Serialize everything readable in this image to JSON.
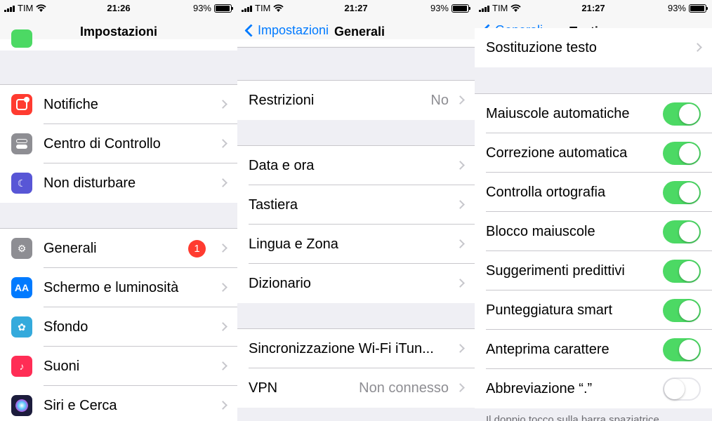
{
  "status_left": {
    "carrier": "TIM",
    "battery_text": "93%",
    "battery_level": 0.93
  },
  "panel1": {
    "time": "21:26",
    "title": "Impostazioni",
    "items": [
      {
        "label": "Notifiche",
        "icon": "notifications-icon",
        "color": "#ff3b30"
      },
      {
        "label": "Centro di Controllo",
        "icon": "control-center-icon",
        "color": "#8e8e93"
      },
      {
        "label": "Non disturbare",
        "icon": "moon-icon",
        "color": "#5856d6"
      },
      {
        "label": "Generali",
        "icon": "gear-icon",
        "color": "#8e8e93",
        "badge": "1"
      },
      {
        "label": "Schermo e luminosità",
        "icon": "display-brightness-icon",
        "color": "#007aff",
        "icon_text": "AA"
      },
      {
        "label": "Sfondo",
        "icon": "wallpaper-flower-icon",
        "color": "#34aadc"
      },
      {
        "label": "Suoni",
        "icon": "speaker-icon",
        "color": "#ff2d55"
      },
      {
        "label": "Siri e Cerca",
        "icon": "siri-icon",
        "color": "#1c1c3c"
      }
    ]
  },
  "panel2": {
    "time": "21:27",
    "back": "Impostazioni",
    "title": "Generali",
    "items": [
      {
        "label": "Restrizioni",
        "detail": "No"
      },
      {
        "label": "Data e ora"
      },
      {
        "label": "Tastiera"
      },
      {
        "label": "Lingua e Zona"
      },
      {
        "label": "Dizionario"
      },
      {
        "label": "Sincronizzazione Wi-Fi iTun..."
      },
      {
        "label": "VPN",
        "detail": "Non connesso"
      }
    ]
  },
  "panel3": {
    "time": "21:27",
    "back": "Generali",
    "title": "Tastiere",
    "top_item": "Sostituzione testo",
    "toggles": [
      {
        "label": "Maiuscole automatiche",
        "on": true
      },
      {
        "label": "Correzione automatica",
        "on": true
      },
      {
        "label": "Controlla ortografia",
        "on": true
      },
      {
        "label": "Blocco maiuscole",
        "on": true
      },
      {
        "label": "Suggerimenti predittivi",
        "on": true
      },
      {
        "label": "Punteggiatura smart",
        "on": true
      },
      {
        "label": "Anteprima carattere",
        "on": true
      },
      {
        "label": "Abbreviazione “.”",
        "on": false
      }
    ],
    "footer": "Il doppio tocco sulla barra spaziatrice"
  },
  "colors": {
    "accent": "#007aff",
    "toggle_on": "#4cd964",
    "badge": "#ff3b30"
  }
}
